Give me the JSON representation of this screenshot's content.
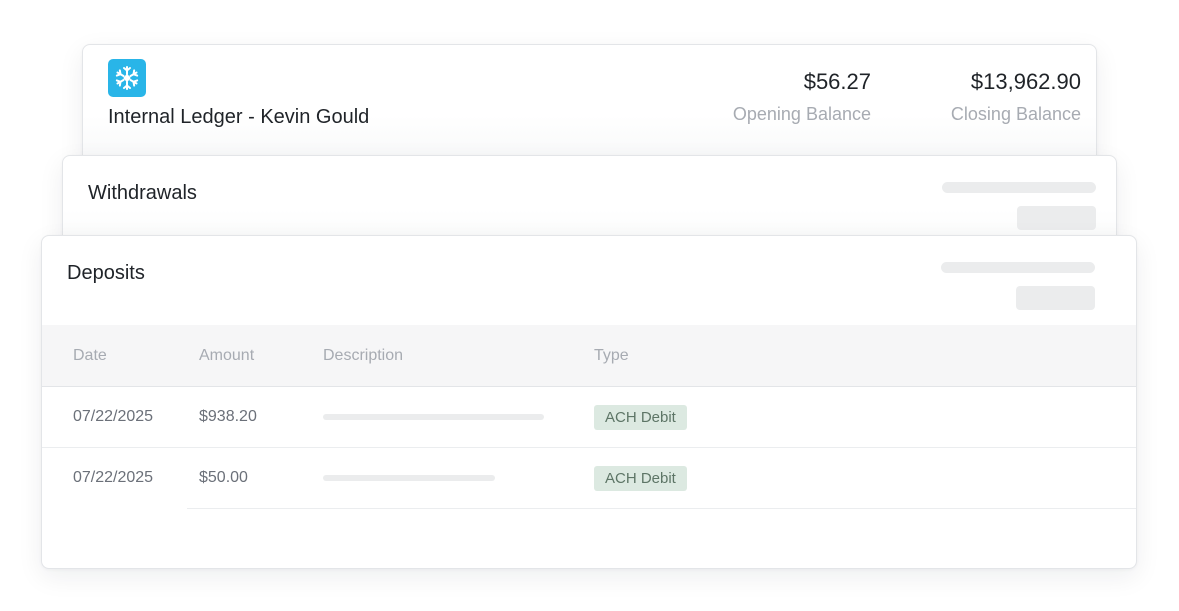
{
  "ledger": {
    "title": "Internal Ledger - Kevin Gould",
    "opening_balance": {
      "value": "$56.27",
      "label": "Opening Balance"
    },
    "closing_balance": {
      "value": "$13,962.90",
      "label": "Closing Balance"
    },
    "logo_icon": "snowflake-icon",
    "logo_color": "#29b5e8"
  },
  "withdrawals": {
    "title": "Withdrawals"
  },
  "deposits": {
    "title": "Deposits",
    "columns": [
      "Date",
      "Amount",
      "Description",
      "Type"
    ],
    "rows": [
      {
        "date": "07/22/2025",
        "amount": "$938.20",
        "type": "ACH Debit"
      },
      {
        "date": "07/22/2025",
        "amount": "$50.00",
        "type": "ACH Debit"
      }
    ]
  }
}
